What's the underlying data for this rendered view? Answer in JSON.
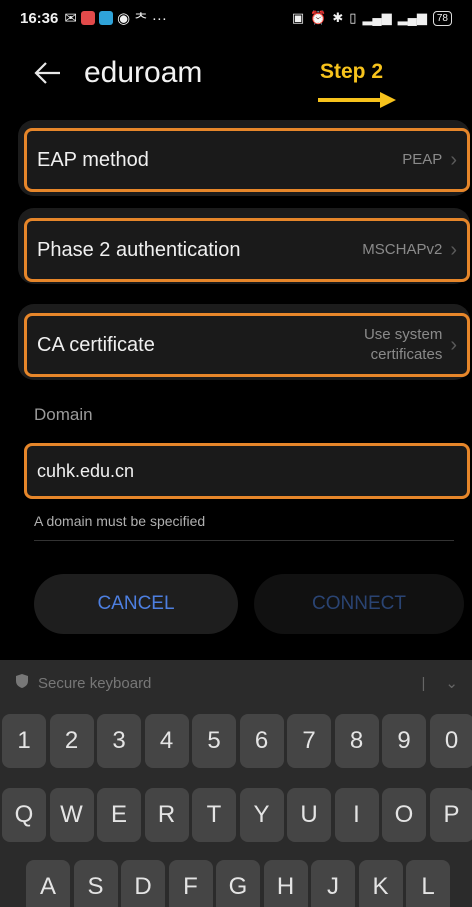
{
  "status_bar": {
    "time": "16:36",
    "left_icons": [
      "message-icon",
      "app-red-icon",
      "app-blue-icon",
      "app-icon",
      "nav-icon",
      "more-icon"
    ],
    "battery": "78"
  },
  "app_bar": {
    "title": "eduroam",
    "step_label": "Step 2"
  },
  "settings": {
    "eap_method": {
      "label": "EAP method",
      "value": "PEAP"
    },
    "phase2": {
      "label": "Phase 2 authentication",
      "value": "MSCHAPv2"
    },
    "ca_cert": {
      "label": "CA certificate",
      "value_line1": "Use system",
      "value_line2": "certificates"
    },
    "domain": {
      "label": "Domain",
      "value": "cuhk.edu.cn",
      "hint": "A domain must be specified"
    }
  },
  "buttons": {
    "cancel": "CANCEL",
    "connect": "CONNECT"
  },
  "keyboard": {
    "title": "Secure keyboard",
    "row_numbers": [
      "1",
      "2",
      "3",
      "4",
      "5",
      "6",
      "7",
      "8",
      "9",
      "0"
    ],
    "row_qwerty": [
      "Q",
      "W",
      "E",
      "R",
      "T",
      "Y",
      "U",
      "I",
      "O",
      "P"
    ],
    "row_asdf": [
      "A",
      "S",
      "D",
      "F",
      "G",
      "H",
      "J",
      "K",
      "L"
    ]
  },
  "colors": {
    "highlight": "#e6862a",
    "step": "#f7c31c",
    "accent": "#4d7fe0"
  }
}
